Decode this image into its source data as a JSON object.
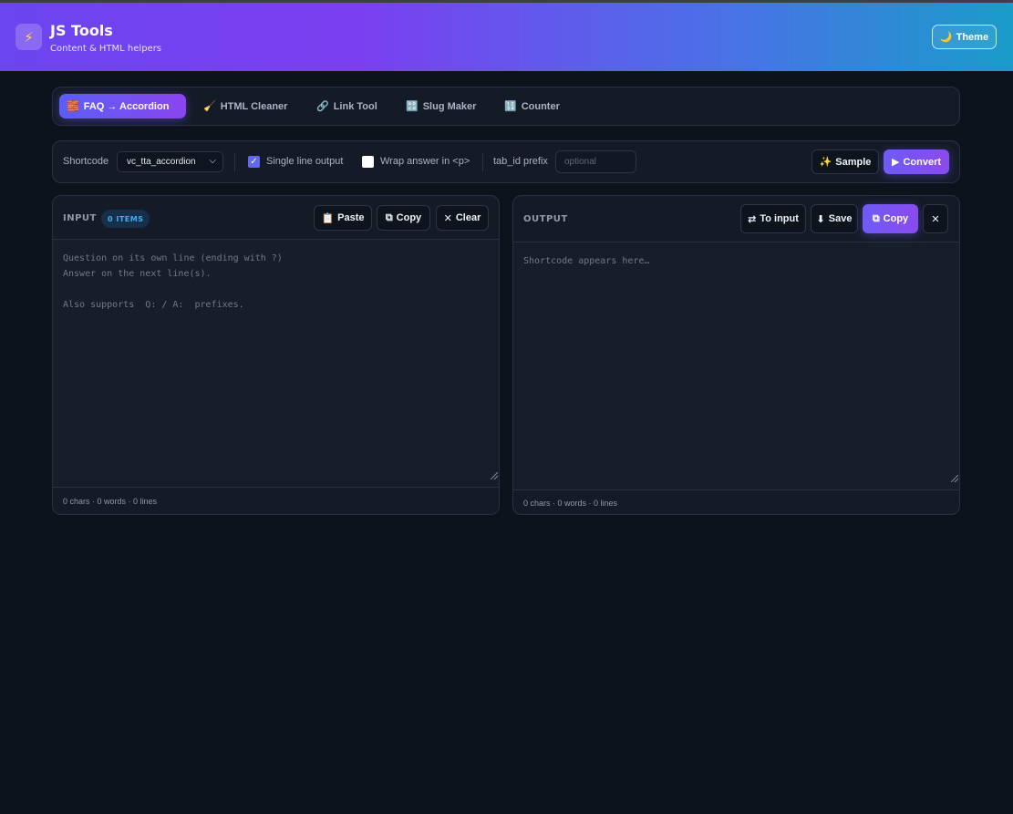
{
  "header": {
    "logo_icon": "⚡",
    "title": "JS Tools",
    "subtitle": "Content & HTML helpers",
    "theme_button": {
      "icon": "🌙",
      "label": "Theme"
    }
  },
  "tabs": [
    {
      "icon": "🧱",
      "label": "FAQ → Accordion",
      "active": true
    },
    {
      "icon": "🧹",
      "label": "HTML Cleaner",
      "active": false
    },
    {
      "icon": "🔗",
      "label": "Link Tool",
      "active": false
    },
    {
      "icon": "🔡",
      "label": "Slug Maker",
      "active": false
    },
    {
      "icon": "🔢",
      "label": "Counter",
      "active": false
    }
  ],
  "toolbar": {
    "shortcode_label": "Shortcode",
    "shortcode_value": "vc_tta_accordion",
    "single_line_label": "Single line output",
    "single_line_checked": true,
    "wrap_label": "Wrap answer in <p>",
    "wrap_checked": false,
    "tab_id_label": "tab_id prefix",
    "tab_id_placeholder": "optional",
    "sample": {
      "icon": "✨",
      "label": "Sample"
    },
    "convert": {
      "icon": "▶",
      "label": "Convert"
    }
  },
  "input": {
    "title": "INPUT",
    "badge": "0 ITEMS",
    "paste": {
      "icon": "📋",
      "label": "Paste"
    },
    "copy": {
      "icon": "⧉",
      "label": "Copy"
    },
    "clear": {
      "icon": "✕",
      "label": "Clear"
    },
    "placeholder": "Question on its own line (ending with ?)\nAnswer on the next line(s).\n\nAlso supports  Q: / A:  prefixes.",
    "stats": "0 chars · 0 words · 0 lines"
  },
  "output": {
    "title": "OUTPUT",
    "to_input": {
      "icon": "⇄",
      "label": "To input"
    },
    "save": {
      "icon": "⬇",
      "label": "Save"
    },
    "copy": {
      "icon": "⧉",
      "label": "Copy"
    },
    "close_icon": "✕",
    "placeholder": "Shortcode appears here…",
    "stats": "0 chars · 0 words · 0 lines"
  },
  "colors": {
    "accent": "#6366f1",
    "accent_2": "#8b45ef",
    "badge_text": "#38b0f5",
    "background": "#0d131d",
    "panel": "#141b27"
  }
}
